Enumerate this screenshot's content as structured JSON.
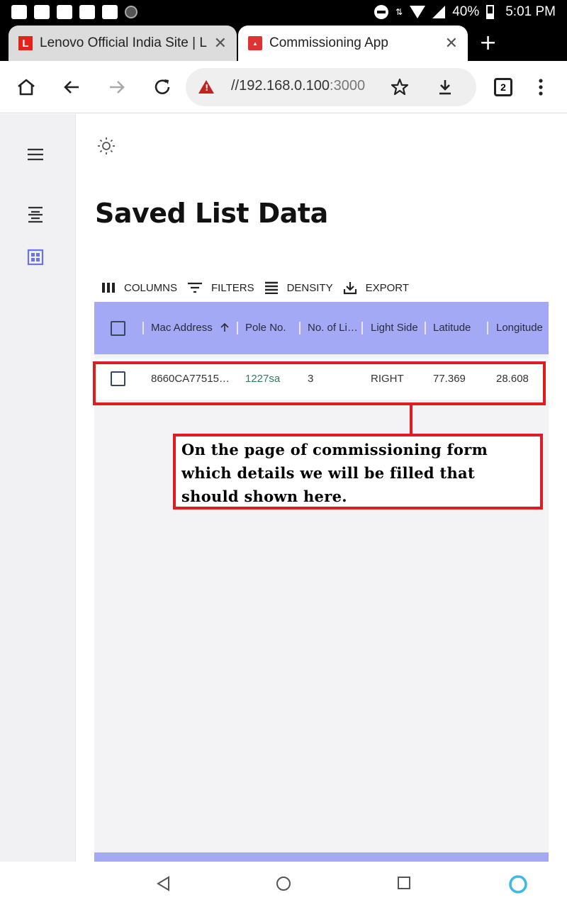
{
  "status_bar": {
    "battery": "40%",
    "time": "5:01 PM"
  },
  "tabs": [
    {
      "title": "Lenovo Official India Site | Laptops",
      "favicon": "L"
    },
    {
      "title": "Commissioning App",
      "favicon": ""
    }
  ],
  "toolbar": {
    "url_host": "//192.168.0.100",
    "url_port": ":3000",
    "tab_count": "2"
  },
  "page": {
    "title": "Saved List Data"
  },
  "grid_toolbar": {
    "columns": "COLUMNS",
    "filters": "FILTERS",
    "density": "DENSITY",
    "export": "EXPORT"
  },
  "table": {
    "headers": [
      "Mac Address",
      "Pole No.",
      "No. of Li…",
      "Light Side",
      "Latitude",
      "Longitude"
    ],
    "rows": [
      [
        "8660CA77515…",
        "1227sa",
        "3",
        "RIGHT",
        "77.369",
        "28.608"
      ]
    ]
  },
  "annotation": {
    "text": "On the page of commissioning form which details we will be  filled that should shown here."
  },
  "colors": {
    "header": "#a4a9f5",
    "annotation": "#e11b22",
    "accent": "#6c72e8"
  }
}
